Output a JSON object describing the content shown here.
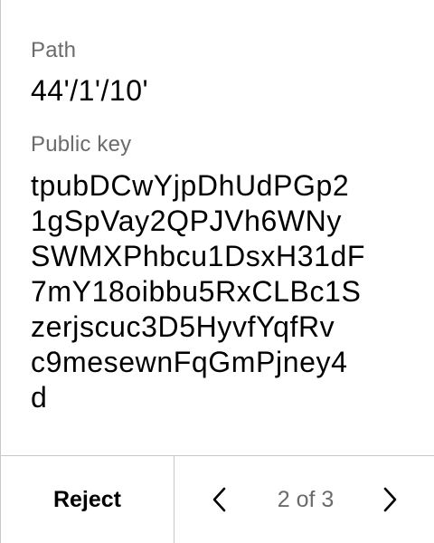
{
  "path": {
    "label": "Path",
    "value": "44'/1'/10'"
  },
  "public_key": {
    "label": "Public key",
    "lines": [
      "tpubDCwYjpDhUdPGp2",
      "1gSpVay2QPJVh6WNy",
      "SWMXPhbcu1DsxH31dF",
      "7mY18oibbu5RxCLBc1S",
      "zerjscuc3D5HyvfYqfRv",
      "c9mesewnFqGmPjney4",
      "d"
    ]
  },
  "footer": {
    "reject_label": "Reject",
    "page_indicator": "2 of 3",
    "prev_icon": "chevron-left-icon",
    "next_icon": "chevron-right-icon"
  }
}
